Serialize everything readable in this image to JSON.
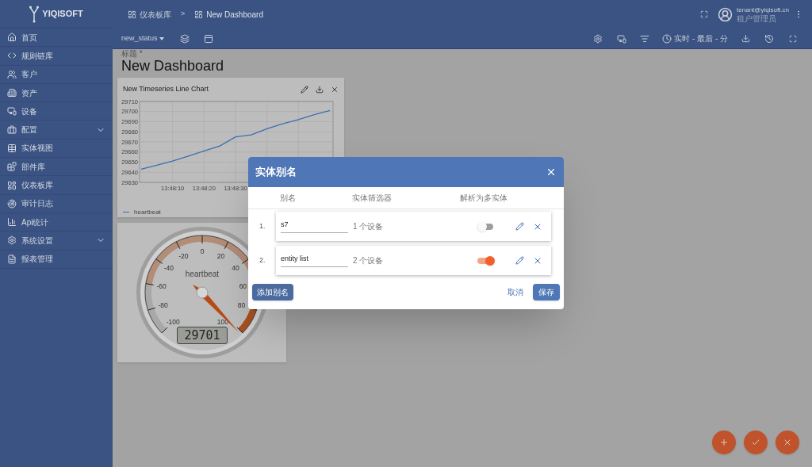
{
  "sidebar": {
    "logo": "YIQISOFT",
    "items": [
      {
        "label": "首页",
        "kind": "link"
      },
      {
        "label": "规则链库",
        "kind": "link"
      },
      {
        "label": "客户",
        "kind": "link"
      },
      {
        "label": "资产",
        "kind": "link"
      },
      {
        "label": "设备",
        "kind": "link"
      },
      {
        "label": "配置",
        "kind": "group"
      },
      {
        "label": "实体视图",
        "kind": "link"
      },
      {
        "label": "部件库",
        "kind": "link"
      },
      {
        "label": "仪表板库",
        "kind": "link"
      },
      {
        "label": "审计日志",
        "kind": "link"
      },
      {
        "label": "Api统计",
        "kind": "link"
      },
      {
        "label": "系统设置",
        "kind": "group"
      },
      {
        "label": "报表管理",
        "kind": "link"
      }
    ]
  },
  "header": {
    "breadcrumb": [
      {
        "label": "仪表板库"
      },
      {
        "label": "New Dashboard"
      }
    ],
    "separator": ">",
    "user": {
      "email": "tenant@yiqisoft.cn",
      "role": "租户管理员"
    }
  },
  "toolbar": {
    "state": "new_status",
    "timewindow": "实时 - 最后 - 分"
  },
  "dashboard": {
    "title_label": "标题 *",
    "title": "New Dashboard"
  },
  "line_widget": {
    "title": "New Timeseries Line Chart",
    "chart_data": {
      "type": "line",
      "grid": true,
      "categories": [
        null,
        null,
        "13:48:10",
        null,
        "13:48:20",
        null,
        "13:48:30",
        null,
        null,
        null,
        null,
        null,
        null
      ],
      "ylim": [
        29630,
        29710
      ],
      "yticks": [
        29630,
        29640,
        29650,
        29660,
        29670,
        29680,
        29690,
        29700,
        29710
      ],
      "series": [
        {
          "name": "heartbeat",
          "color": "#3a6fb5",
          "values": [
            29643,
            29647,
            29651,
            29656,
            29661,
            29666,
            29675,
            29677,
            29683,
            29688,
            29692,
            29697,
            29701
          ]
        }
      ]
    }
  },
  "gauge_widget": {
    "label": "heartbeat",
    "value": "29701",
    "ticks": [
      "-100",
      "-80",
      "-60",
      "-40",
      "-20",
      "0",
      "20",
      "40",
      "60",
      "80",
      "100"
    ]
  },
  "dialog": {
    "title": "实体别名",
    "columns": [
      "别名",
      "实体筛选器",
      "解析为多实体"
    ],
    "rows": [
      {
        "number": "1.",
        "alias": "s7",
        "filter": "1 个设备",
        "multiple": false
      },
      {
        "number": "2.",
        "alias": "entity list",
        "filter": "2 个设备",
        "multiple": true
      }
    ],
    "add_button": "添加别名",
    "cancel_button": "取消",
    "save_button": "保存"
  }
}
